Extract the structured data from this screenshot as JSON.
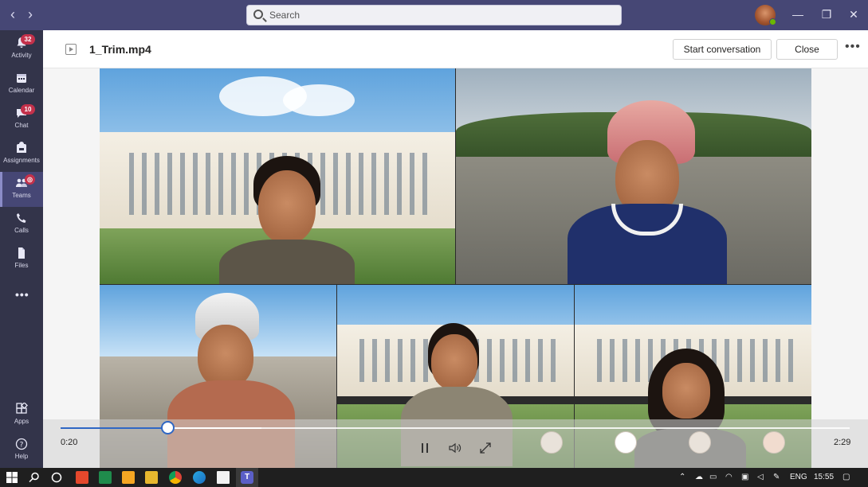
{
  "titlebar": {
    "back_icon": "chevron-left-icon",
    "forward_icon": "chevron-right-icon",
    "search_placeholder": "Search",
    "window_controls": [
      "minimize-icon",
      "restore-icon",
      "close-icon"
    ]
  },
  "rail": {
    "items": [
      {
        "label": "Activity",
        "icon": "bell-icon",
        "badge": "32"
      },
      {
        "label": "Calendar",
        "icon": "calendar-icon",
        "badge": ""
      },
      {
        "label": "Chat",
        "icon": "chat-icon",
        "badge": "10"
      },
      {
        "label": "Assignments",
        "icon": "backpack-icon",
        "badge": ""
      },
      {
        "label": "Teams",
        "icon": "teams-icon",
        "badge": "",
        "active": true
      },
      {
        "label": "Calls",
        "icon": "phone-icon",
        "badge": ""
      },
      {
        "label": "Files",
        "icon": "file-icon",
        "badge": ""
      },
      {
        "label": "",
        "icon": "more-icon",
        "badge": ""
      }
    ],
    "bottom": [
      {
        "label": "Apps",
        "icon": "apps-icon"
      },
      {
        "label": "Help",
        "icon": "help-icon"
      }
    ]
  },
  "header": {
    "file_name": "1_Trim.mp4",
    "start_conversation": "Start conversation",
    "close": "Close",
    "more_icon": "more-options-icon"
  },
  "player": {
    "current_time": "0:20",
    "duration": "2:29",
    "progress_fraction": 0.135,
    "buffered_fraction": 0.255
  },
  "colors": {
    "titlebar": "#464775",
    "rail": "#33344a",
    "accent": "#2f67c4",
    "badge": "#c4314b"
  },
  "taskbar": {
    "language": "ENG",
    "time": "15:55"
  }
}
